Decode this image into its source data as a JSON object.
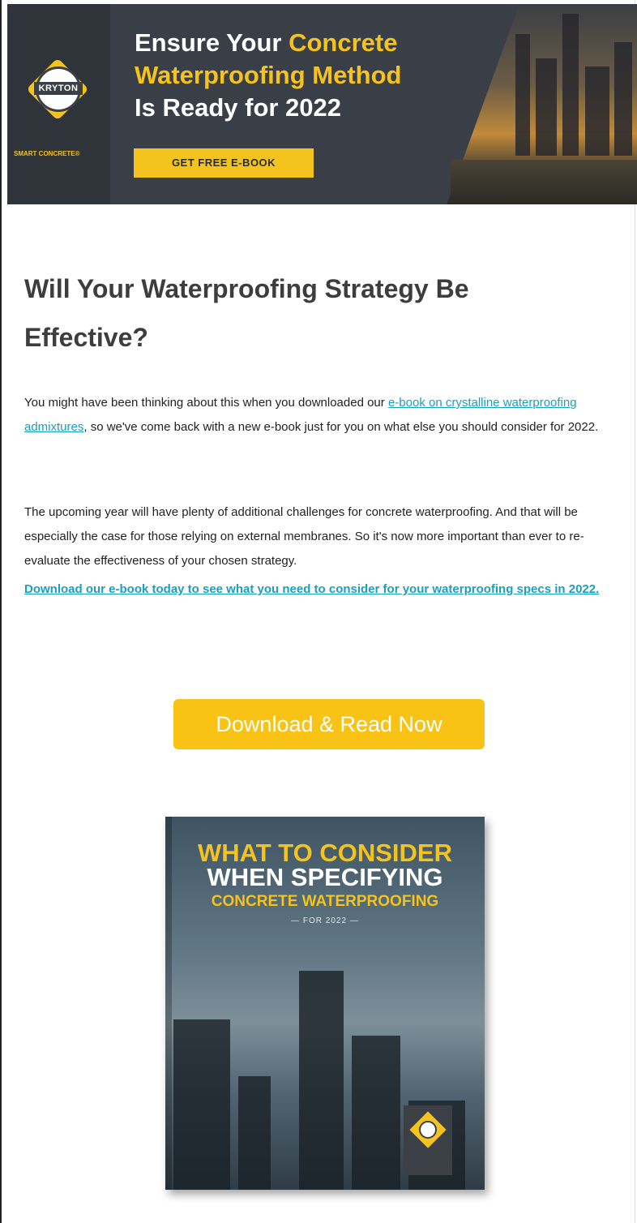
{
  "banner": {
    "title_part1": "Ensure Your ",
    "title_highlight1": "Concrete",
    "title_highlight2": "Waterproofing Method",
    "title_part3": "Is Ready for 2022",
    "button_label": "GET FREE E-BOOK",
    "logo_text": "KRYTON",
    "logo_tagline": "SMART CONCRETE®"
  },
  "article": {
    "heading": "Will Your Waterproofing Strategy Be Effective?",
    "p1_before_link": "You might have been thinking about this when you downloaded our ",
    "p1_link": "e-book on crystalline waterproofing admixtures",
    "p1_after_link": ", so we've come back with a new e-book just for you on what else you should consider for 2022.",
    "p2": "The upcoming year will have plenty of additional challenges for concrete waterproofing. And that will be especially the case for those relying on external membranes. So it's now more important than ever to re-evaluate the effectiveness of your chosen strategy.",
    "p3_link": "Download our e-book today to see what you need to consider for your waterproofing specs in 2022."
  },
  "cta": {
    "label": "Download & Read Now"
  },
  "book": {
    "line1": "WHAT TO CONSIDER",
    "line2": "WHEN SPECIFYING",
    "line3": "CONCRETE WATERPROOFING",
    "line4": "— FOR 2022 —"
  },
  "colors": {
    "accent": "#f4c31e",
    "link": "#1a9fbf",
    "banner_bg": "#3a3f47"
  }
}
